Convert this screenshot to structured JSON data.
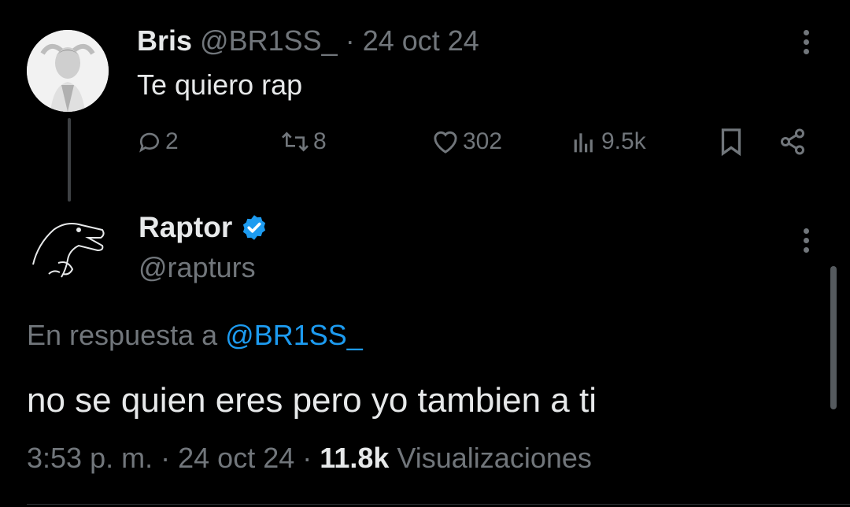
{
  "parent_tweet": {
    "display_name": "Bris",
    "handle": "@BR1SS_",
    "separator": "·",
    "date": "24 oct 24",
    "text": "Te quiero rap",
    "actions": {
      "replies": "2",
      "reposts": "8",
      "likes": "302",
      "views": "9.5k"
    }
  },
  "reply_tweet": {
    "display_name": "Raptor",
    "handle": "@rapturs",
    "verified": true,
    "reply_prefix": "En respuesta a",
    "reply_target": "@BR1SS_",
    "text": "no se quien eres pero yo tambien a ti",
    "time": "3:53 p. m.",
    "separator": "·",
    "date": "24 oct 24",
    "views_count": "11.8k",
    "views_label": "Visualizaciones"
  },
  "colors": {
    "background": "#000000",
    "text": "#e7e9ea",
    "muted": "#71767b",
    "accent": "#1d9bf0"
  },
  "icons": {
    "reply": "reply-icon",
    "repost": "repost-icon",
    "like": "heart-icon",
    "views": "views-icon",
    "bookmark": "bookmark-icon",
    "share": "share-icon",
    "more": "more-icon",
    "verified": "verified-badge-icon"
  }
}
